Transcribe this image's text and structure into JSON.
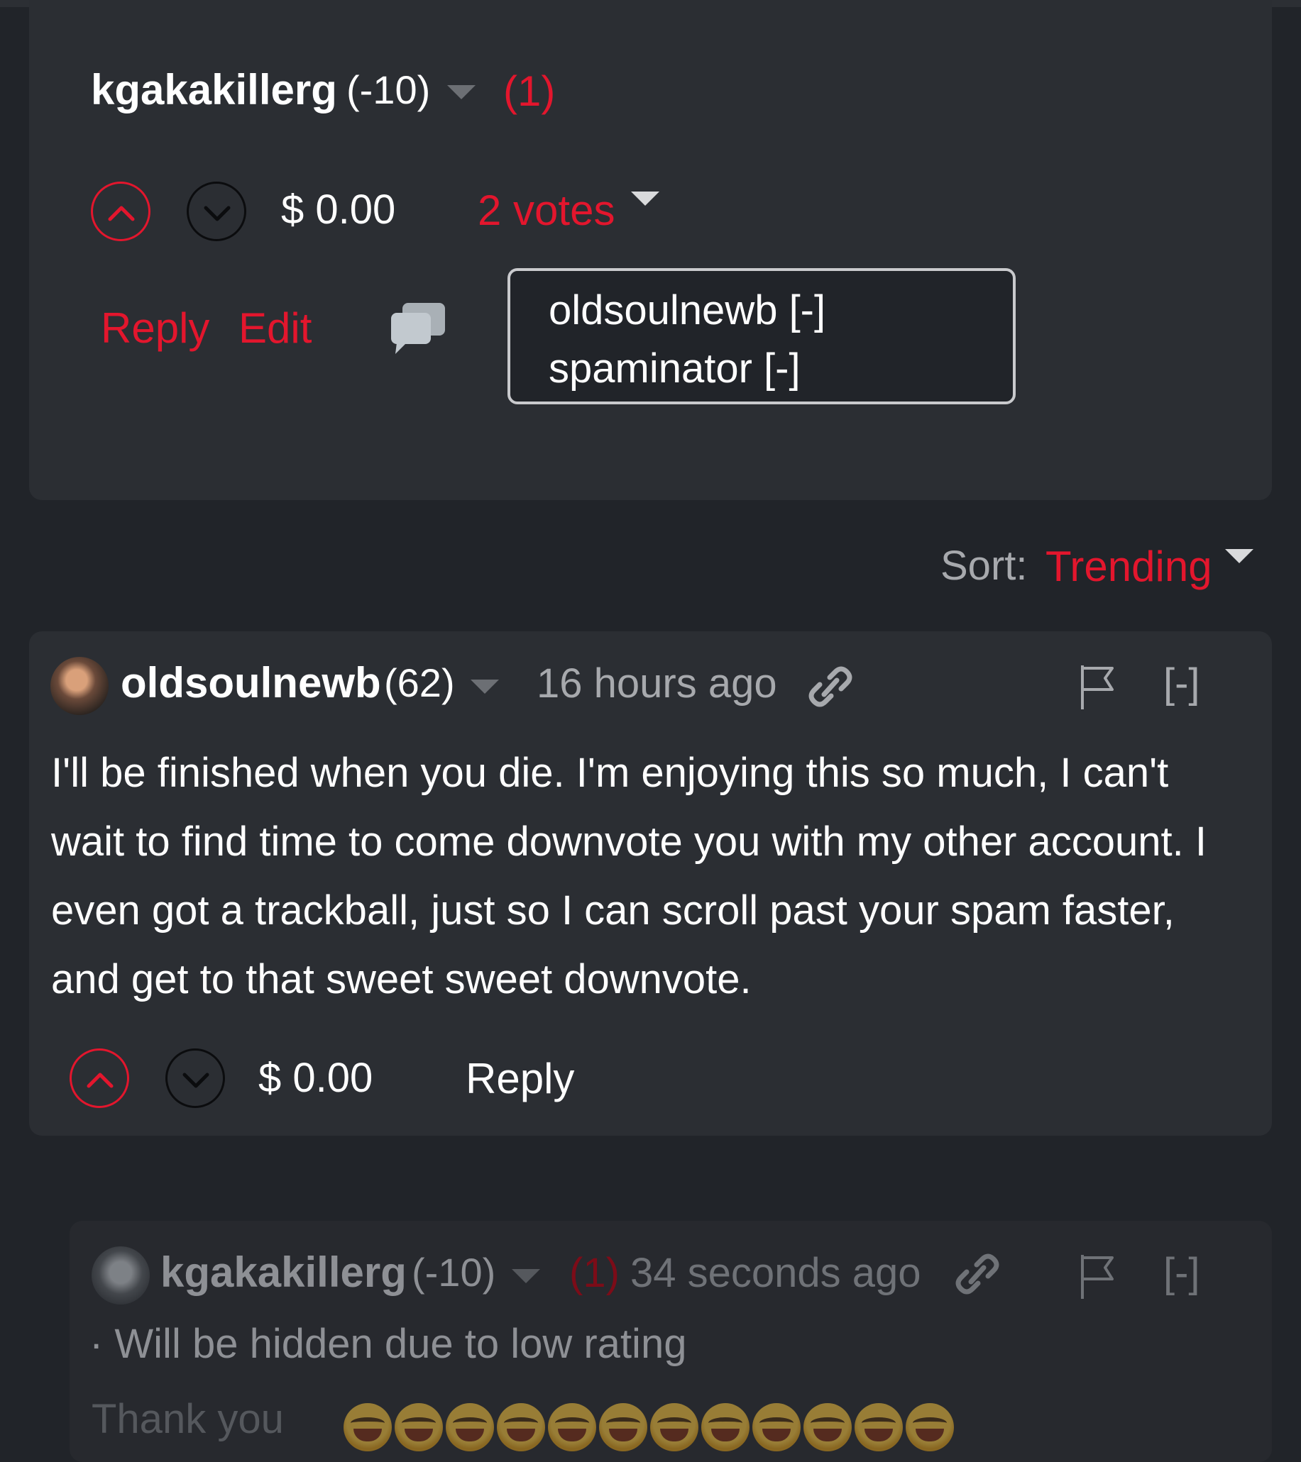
{
  "parent_comment": {
    "author": "kgakakillerg",
    "reputation": "(-10)",
    "count_badge": "(1)",
    "payout": "$ 0.00",
    "votes_label": "2 votes",
    "reply_label": "Reply",
    "edit_label": "Edit",
    "voters": [
      "oldsoulnewb [-]",
      "spaminator [-]"
    ]
  },
  "sort": {
    "label": "Sort:",
    "value": "Trending"
  },
  "comment": {
    "author": "oldsoulnewb",
    "reputation": "(62)",
    "time": "16 hours ago",
    "collapse_label": "[-]",
    "body": "I'll be finished when you die. I'm enjoying this so much, I can't wait to find time to come downvote you with my other account. I even got a trackball, just so I can scroll past your spam faster, and get to that sweet sweet downvote.",
    "payout": "$ 0.00",
    "reply_label": "Reply"
  },
  "reply": {
    "author": "kgakakillerg",
    "reputation": "(-10)",
    "count_badge": "(1)",
    "time": "34 seconds ago",
    "collapse_label": "[-]",
    "hidden_notice": "· Will be hidden due to low rating",
    "body_text": "Thank  you",
    "emoji_count": 12
  },
  "colors": {
    "background": "#212429",
    "card": "#2b2e33",
    "accent_red": "#e3162d",
    "muted_text": "#a7a9ad"
  }
}
